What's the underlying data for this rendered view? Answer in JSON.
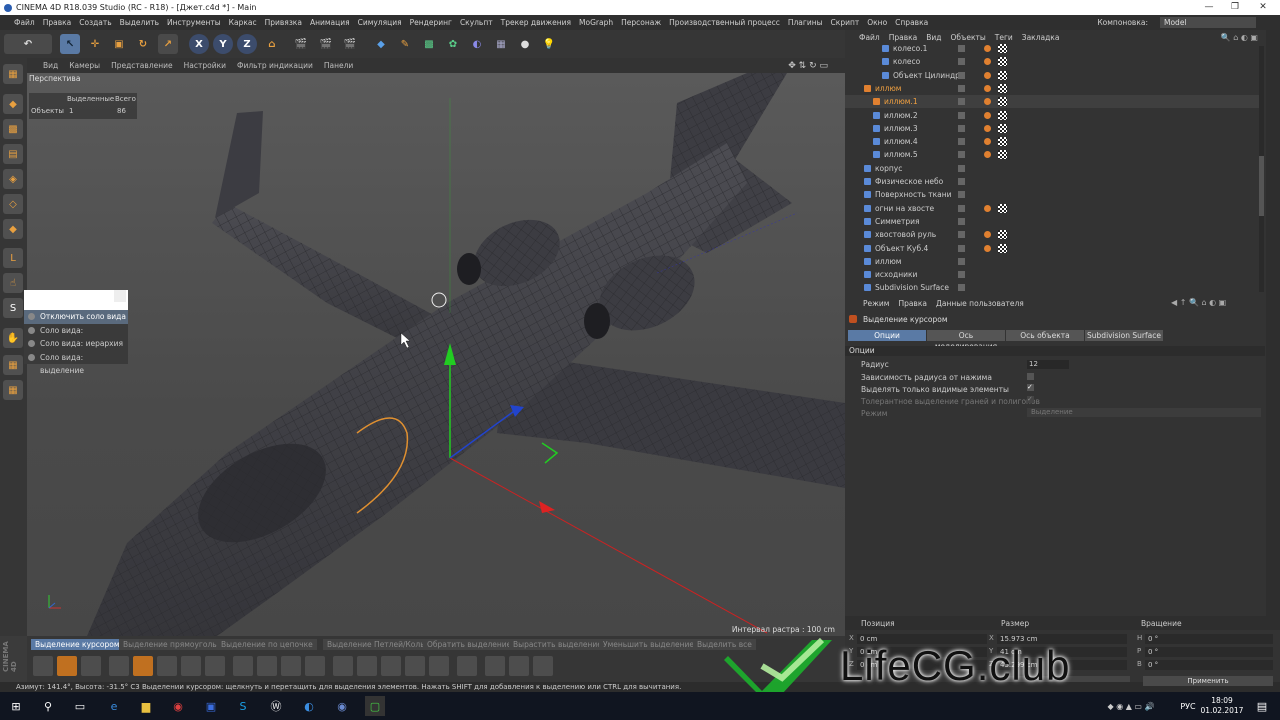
{
  "window": {
    "title": "CINEMA 4D R18.039 Studio (RC - R18) - [Джет.c4d *] - Main",
    "controls": [
      "—",
      "❐",
      "✕"
    ]
  },
  "menubar": {
    "items": [
      "Файл",
      "Правка",
      "Создать",
      "Выделить",
      "Инструменты",
      "Каркас",
      "Привязка",
      "Анимация",
      "Симуляция",
      "Рендеринг",
      "Скульпт",
      "Трекер движения",
      "MoGraph",
      "Персонаж",
      "Производственный процесс",
      "Плагины",
      "Скрипт",
      "Окно",
      "Справка"
    ],
    "layout_label": "Компоновка:",
    "layout_value": "Model"
  },
  "viewport": {
    "menu": [
      "Вид",
      "Камеры",
      "Представление",
      "Настройки",
      "Фильтр индикации",
      "Панели"
    ],
    "label": "Перспектива",
    "hud": {
      "col1": "Выделенные",
      "col2": "Всего",
      "row_label": "Объекты",
      "selected": "1",
      "total": "86"
    },
    "grid_interval": "Интервал растра : 100 cm"
  },
  "solo_dropdown": {
    "items": [
      "Отключить соло вида",
      "Соло вида: отдельный",
      "Соло вида: иерархия",
      "Соло вида: выделение"
    ],
    "selected_index": 0
  },
  "bottom_toolbar": {
    "tabs": [
      "Выделение курсором",
      "Выделение прямоугольником",
      "Выделение по цепочке",
      "Выделение Петлей/Кольцом",
      "Обратить выделение",
      "Вырастить выделение",
      "Уменьшить выделение",
      "Выделить все"
    ]
  },
  "statusbar": {
    "text": "Азимут: 141.4°, Высота: -31.5°  C3    Выделении курсором: щелкнуть и перетащить для выделения элементов. Нажать SHIFT для добавления к выделению или CTRL для вычитания."
  },
  "object_manager": {
    "menu": [
      "Файл",
      "Правка",
      "Вид",
      "Объекты",
      "Теги",
      "Закладка"
    ],
    "rows": [
      {
        "name": "колесо.1",
        "indent": 3,
        "tags": 1
      },
      {
        "name": "колесо",
        "indent": 3,
        "tags": 1
      },
      {
        "name": "Объект Цилиндр",
        "indent": 3,
        "tags": 1
      },
      {
        "name": "иллюм",
        "indent": 1,
        "tags": 1,
        "orange": true
      },
      {
        "name": "иллюм.1",
        "indent": 2,
        "tags": 1,
        "orange": true,
        "selected": true
      },
      {
        "name": "иллюм.2",
        "indent": 2,
        "tags": 1
      },
      {
        "name": "иллюм.3",
        "indent": 2,
        "tags": 1
      },
      {
        "name": "иллюм.4",
        "indent": 2,
        "tags": 1
      },
      {
        "name": "иллюм.5",
        "indent": 2,
        "tags": 1
      },
      {
        "name": "корпус",
        "indent": 1,
        "tags": 0
      },
      {
        "name": "Физическое небо",
        "indent": 1,
        "tags": 0
      },
      {
        "name": "Поверхность ткани",
        "indent": 1,
        "tags": 0
      },
      {
        "name": "огни на хвосте",
        "indent": 1,
        "tags": 1
      },
      {
        "name": "Симметрия",
        "indent": 1,
        "tags": 0
      },
      {
        "name": "хвостовой руль",
        "indent": 1,
        "tags": 1
      },
      {
        "name": "Объект Куб.4",
        "indent": 1,
        "tags": 1
      },
      {
        "name": "иллюм",
        "indent": 1,
        "tags": 0
      },
      {
        "name": "исходники",
        "indent": 1,
        "tags": 0
      },
      {
        "name": "Subdivision Surface",
        "indent": 1,
        "tags": 0
      }
    ]
  },
  "attribute_manager": {
    "menu": [
      "Режим",
      "Правка",
      "Данные пользователя"
    ],
    "tool_name": "Выделение курсором",
    "tabs": [
      "Опции",
      "Ось моделирования",
      "Ось объекта",
      "Subdivision Surface"
    ],
    "section": "Опции",
    "fields": {
      "radius_label": "Радиус",
      "radius_value": "12",
      "pressure_label": "Зависимость радиуса от нажима",
      "visible_label": "Выделять только видимые элементы",
      "tolerant_label": "Толерантное выделение граней и полигонов",
      "mode_label": "Режим",
      "mode_value": "Выделение"
    }
  },
  "coordinates": {
    "headers": [
      "Позиция",
      "Размер",
      "Вращение"
    ],
    "rows": [
      {
        "axis": "X",
        "pos": "0 cm",
        "size_axis": "X",
        "size": "15.973 cm",
        "rot_axis": "H",
        "rot": "0 °"
      },
      {
        "axis": "Y",
        "pos": "0 cm",
        "size_axis": "Y",
        "size": "41 cm",
        "rot_axis": "P",
        "rot": "0 °"
      },
      {
        "axis": "Z",
        "pos": "0 cm",
        "size_axis": "Z",
        "size": "43.299 cm",
        "rot_axis": "B",
        "rot": "0 °"
      }
    ],
    "apply": "Применить"
  },
  "watermark": {
    "text": "LifeCG.club"
  },
  "taskbar": {
    "lang": "РУС",
    "time": "18:09",
    "date": "01.02.2017"
  }
}
